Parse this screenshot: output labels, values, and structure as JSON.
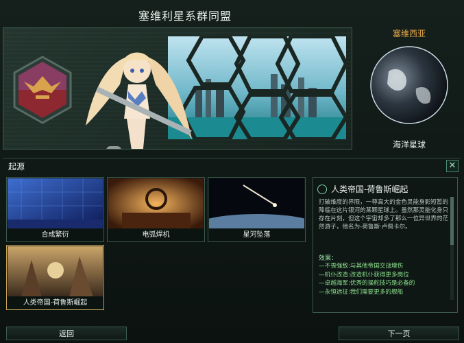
{
  "window": {
    "title": "塞维利星系群同盟"
  },
  "planet": {
    "name": "塞维西亚",
    "type": "海洋星球"
  },
  "origins": {
    "section_title": "起源",
    "cards": [
      {
        "label": "合成繁衍"
      },
      {
        "label": "电弧焊机"
      },
      {
        "label": "星河坠落"
      },
      {
        "label": "人类帝国-荷鲁斯崛起"
      }
    ]
  },
  "detail": {
    "title": "人类帝国-荷鲁斯崛起",
    "description": "打破维度的界限，一尊高大的金色灵能身影短暂的降临在这片银河的某颗星球上。虽然那灵能化身只存在片刻，但这个宇宙却多了那么一位异世界的茫然游子，他名为-荷鲁斯·卢佩卡尔。",
    "effects_title": "效果：",
    "effects": [
      "—不畏强敌:与其他帝国交战增伤",
      "—机仆改造:改造机仆获得更多岗位",
      "—卓越海军:优秀的操舵技巧是必备的",
      "—永恒远征:我们需要更多的舰船"
    ]
  },
  "buttons": {
    "back": "返回",
    "next": "下一页",
    "close": "✕"
  },
  "colors": {
    "accent_gold": "#e3a64a",
    "effect_green": "#8ee28f",
    "frame_teal": "#3b5a4d"
  }
}
